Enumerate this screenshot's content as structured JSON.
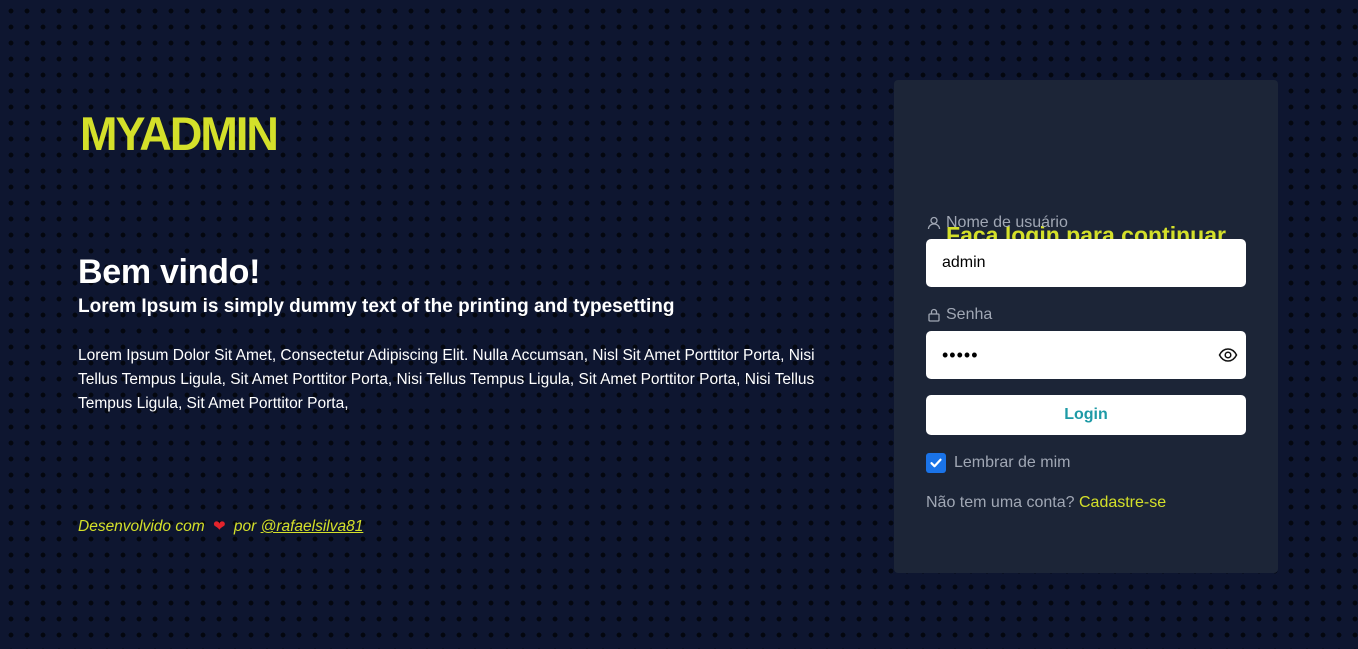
{
  "brand": {
    "logo": "MYADMIN",
    "accent_color": "#d4e02a"
  },
  "hero": {
    "heading": "Bem vindo!",
    "subheading": "Lorem Ipsum is simply dummy text of the printing and typesetting",
    "description": "Lorem Ipsum Dolor Sit Amet, Consectetur Adipiscing Elit. Nulla Accumsan, Nisl Sit Amet Porttitor Porta, Nisi Tellus Tempus Ligula, Sit Amet Porttitor Porta, Nisi Tellus Tempus Ligula, Sit Amet Porttitor Porta, Nisi Tellus Tempus Ligula, Sit Amet Porttitor Porta,"
  },
  "credit": {
    "prefix": "Desenvolvido com",
    "heart": "❤",
    "by": "por",
    "author_link": "@rafaelsilva81"
  },
  "login_card": {
    "title": "Faça login para continuar",
    "username": {
      "label": "Nome de usuário",
      "value": "admin",
      "icon": "user-icon"
    },
    "password": {
      "label": "Senha",
      "masked_value": "•••••",
      "icon": "lock-icon",
      "toggle_icon": "eye-icon"
    },
    "submit_label": "Login",
    "remember": {
      "label": "Lembrar de mim",
      "checked": true
    },
    "signup": {
      "prompt": "Não tem uma conta?",
      "link": "Cadastre-se"
    }
  },
  "colors": {
    "background": "#0e1630",
    "card": "#1c2537",
    "accent": "#d4e02a",
    "button_text": "#1e9aa6",
    "checkbox": "#1a73e8",
    "muted_text": "#a0a7b4",
    "heart": "#e3232c"
  }
}
